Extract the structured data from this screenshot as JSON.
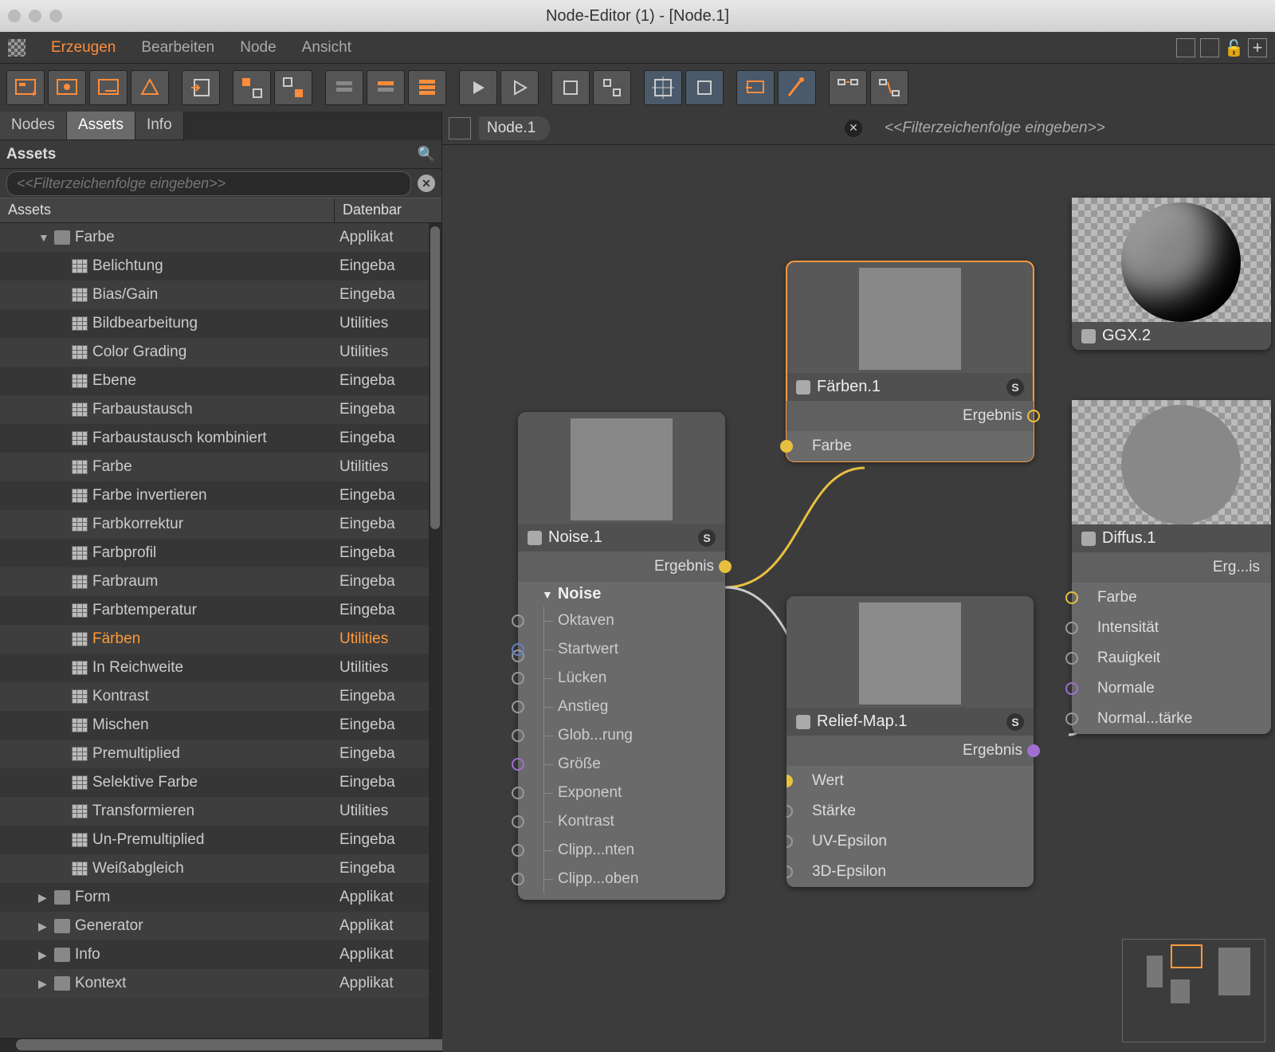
{
  "window": {
    "title": "Node-Editor (1) - [Node.1]"
  },
  "menu": {
    "items": [
      "Erzeugen",
      "Bearbeiten",
      "Node",
      "Ansicht"
    ],
    "active_index": 0
  },
  "sidebar": {
    "tabs": [
      "Nodes",
      "Assets",
      "Info"
    ],
    "active_tab": 1,
    "panel_title": "Assets",
    "search_placeholder": "<<Filterzeichenfolge eingeben>>",
    "columns": {
      "name": "Assets",
      "db": "Datenbar"
    },
    "rows": [
      {
        "indent": 1,
        "type": "folder",
        "arrow": "▼",
        "label": "Farbe",
        "db": "Applikat"
      },
      {
        "indent": 2,
        "type": "item",
        "label": "Belichtung",
        "db": "Eingeba"
      },
      {
        "indent": 2,
        "type": "item",
        "label": "Bias/Gain",
        "db": "Eingeba"
      },
      {
        "indent": 2,
        "type": "item",
        "label": "Bildbearbeitung",
        "db": "Utilities"
      },
      {
        "indent": 2,
        "type": "item",
        "label": "Color Grading",
        "db": "Utilities"
      },
      {
        "indent": 2,
        "type": "item",
        "label": "Ebene",
        "db": "Eingeba"
      },
      {
        "indent": 2,
        "type": "item",
        "label": "Farbaustausch",
        "db": "Eingeba"
      },
      {
        "indent": 2,
        "type": "item",
        "label": "Farbaustausch kombiniert",
        "db": "Eingeba"
      },
      {
        "indent": 2,
        "type": "item",
        "label": "Farbe",
        "db": "Utilities"
      },
      {
        "indent": 2,
        "type": "item",
        "label": "Farbe invertieren",
        "db": "Eingeba"
      },
      {
        "indent": 2,
        "type": "item",
        "label": "Farbkorrektur",
        "db": "Eingeba"
      },
      {
        "indent": 2,
        "type": "item",
        "label": "Farbprofil",
        "db": "Eingeba"
      },
      {
        "indent": 2,
        "type": "item",
        "label": "Farbraum",
        "db": "Eingeba"
      },
      {
        "indent": 2,
        "type": "item",
        "label": "Farbtemperatur",
        "db": "Eingeba"
      },
      {
        "indent": 2,
        "type": "item",
        "label": "Färben",
        "db": "Utilities",
        "hl": true
      },
      {
        "indent": 2,
        "type": "item",
        "label": "In Reichweite",
        "db": "Utilities"
      },
      {
        "indent": 2,
        "type": "item",
        "label": "Kontrast",
        "db": "Eingeba"
      },
      {
        "indent": 2,
        "type": "item",
        "label": "Mischen",
        "db": "Eingeba"
      },
      {
        "indent": 2,
        "type": "item",
        "label": "Premultiplied",
        "db": "Eingeba"
      },
      {
        "indent": 2,
        "type": "item",
        "label": "Selektive Farbe",
        "db": "Eingeba"
      },
      {
        "indent": 2,
        "type": "item",
        "label": "Transformieren",
        "db": "Utilities"
      },
      {
        "indent": 2,
        "type": "item",
        "label": "Un-Premultiplied",
        "db": "Eingeba"
      },
      {
        "indent": 2,
        "type": "item",
        "label": "Weißabgleich",
        "db": "Eingeba"
      },
      {
        "indent": 1,
        "type": "folder",
        "arrow": "▶",
        "label": "Form",
        "db": "Applikat"
      },
      {
        "indent": 1,
        "type": "folder",
        "arrow": "▶",
        "label": "Generator",
        "db": "Applikat"
      },
      {
        "indent": 1,
        "type": "folder",
        "arrow": "▶",
        "label": "Info",
        "db": "Applikat"
      },
      {
        "indent": 1,
        "type": "folder",
        "arrow": "▶",
        "label": "Kontext",
        "db": "Applikat"
      }
    ]
  },
  "canvas": {
    "breadcrumb": "Node.1",
    "filter_placeholder": "<<Filterzeichenfolge eingeben>>"
  },
  "nodes": {
    "noise": {
      "title": "Noise.1",
      "out": "Ergebnis",
      "group": "Noise",
      "params": [
        "Oktaven",
        "Startwert",
        "Lücken",
        "Anstieg",
        "Glob...rung",
        "Größe",
        "Exponent",
        "Kontrast",
        "Clipp...nten",
        "Clipp...oben"
      ]
    },
    "faerben": {
      "title": "Färben.1",
      "out": "Ergebnis",
      "in": "Farbe"
    },
    "relief": {
      "title": "Relief-Map.1",
      "out": "Ergebnis",
      "ins": [
        "Wert",
        "Stärke",
        "UV-Epsilon",
        "3D-Epsilon"
      ]
    },
    "ggx": {
      "title": "GGX.2"
    },
    "diffus": {
      "title": "Diffus.1",
      "out": "Erg...is",
      "ins": [
        "Farbe",
        "Intensität",
        "Rauigkeit",
        "Normale",
        "Normal...tärke"
      ]
    }
  }
}
